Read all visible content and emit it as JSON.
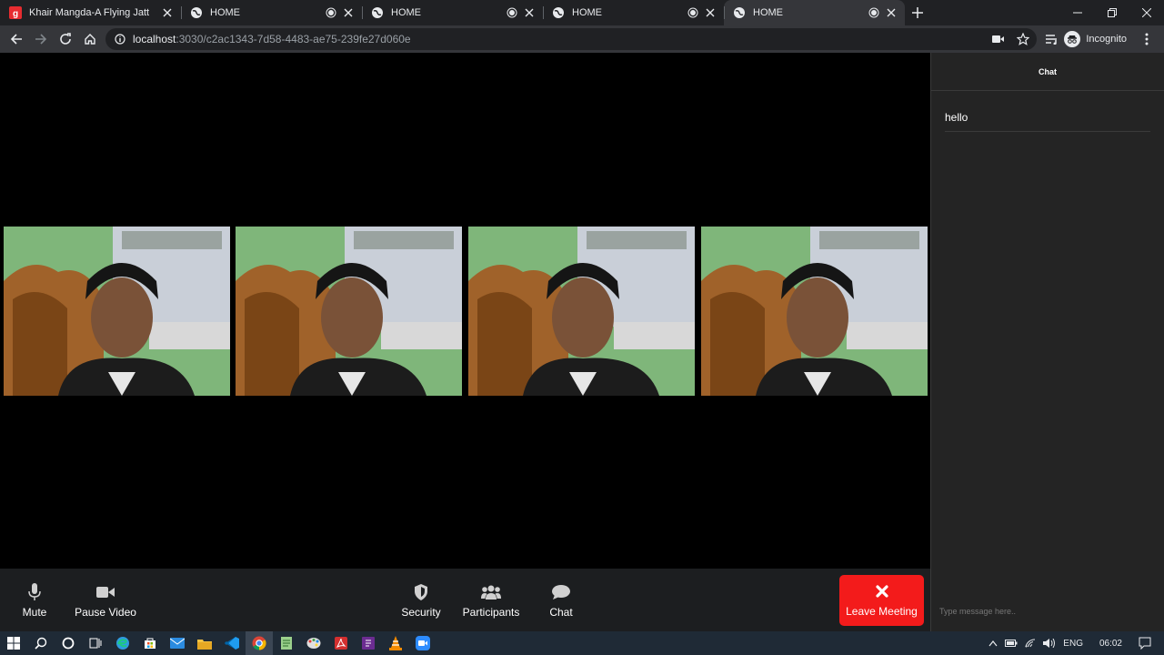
{
  "browser": {
    "tabs": [
      {
        "title": "Khair Mangda-A Flying Jatt",
        "icon": "gaana-icon",
        "recording": false,
        "active": false
      },
      {
        "title": "HOME",
        "icon": "globe-icon",
        "recording": true,
        "active": false
      },
      {
        "title": "HOME",
        "icon": "globe-icon",
        "recording": true,
        "active": false
      },
      {
        "title": "HOME",
        "icon": "globe-icon",
        "recording": true,
        "active": false
      },
      {
        "title": "HOME",
        "icon": "globe-icon",
        "recording": true,
        "active": true
      }
    ],
    "address": {
      "host": "localhost",
      "path": ":3030/c2ac1343-7d58-4483-ae75-239fe27d060e"
    },
    "profile_label": "Incognito"
  },
  "meeting": {
    "videos": [
      {
        "name": "participant-video-1"
      },
      {
        "name": "participant-video-2"
      },
      {
        "name": "participant-video-3"
      },
      {
        "name": "participant-video-4"
      }
    ],
    "controls": {
      "mute": "Mute",
      "pause_video": "Pause Video",
      "security": "Security",
      "participants": "Participants",
      "chat": "Chat",
      "leave": "Leave Meeting"
    },
    "leave_color": "#f31b1b"
  },
  "chat_panel": {
    "title": "Chat",
    "messages": [
      {
        "text": "hello"
      }
    ],
    "input_placeholder": "Type message here.."
  },
  "taskbar": {
    "language": "ENG",
    "time": "06:02"
  }
}
